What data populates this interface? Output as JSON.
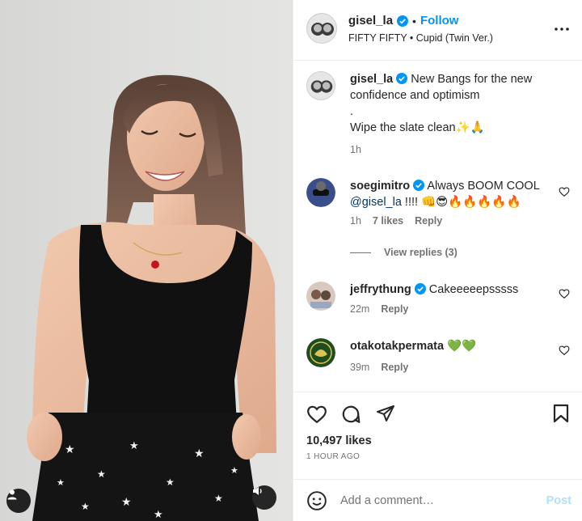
{
  "post": {
    "author": "gisel_la",
    "follow_label": "Follow",
    "separator": "•",
    "audio": "FIFTY FIFTY • Cupid (Twin Ver.)"
  },
  "caption": {
    "username": "gisel_la",
    "line1": "New Bangs for the new confidence and optimism",
    "dot": ".",
    "line2": "Wipe the slate clean✨🙏",
    "time": "1h"
  },
  "comments": [
    {
      "username": "soegimitro",
      "verified": true,
      "text": "Always BOOM COOL",
      "mention": "@gisel_la",
      "after": " !!!! 👊😎🔥🔥🔥🔥🔥",
      "time": "1h",
      "likes": "7 likes",
      "reply": "Reply"
    },
    {
      "username": "jeffrythung",
      "verified": true,
      "text": "Cakeeeeepsssss",
      "time": "22m",
      "reply": "Reply"
    },
    {
      "username": "otakotakpermata",
      "verified": false,
      "text": "💚💚",
      "time": "39m",
      "reply": "Reply"
    }
  ],
  "view_replies": "View replies (3)",
  "likes": "10,497 likes",
  "posted_ago": "1 HOUR AGO",
  "composer": {
    "placeholder": "Add a comment…",
    "post_label": "Post"
  },
  "colors": {
    "accent": "#0095f6",
    "post_disabled": "#b2dffc",
    "verified": "#0095f6",
    "secondary_text": "#737373"
  },
  "icons": [
    "user-icon",
    "speaker-icon",
    "more-icon",
    "verified-icon",
    "heart-icon",
    "comment-icon",
    "share-icon",
    "bookmark-icon",
    "emoji-icon"
  ]
}
